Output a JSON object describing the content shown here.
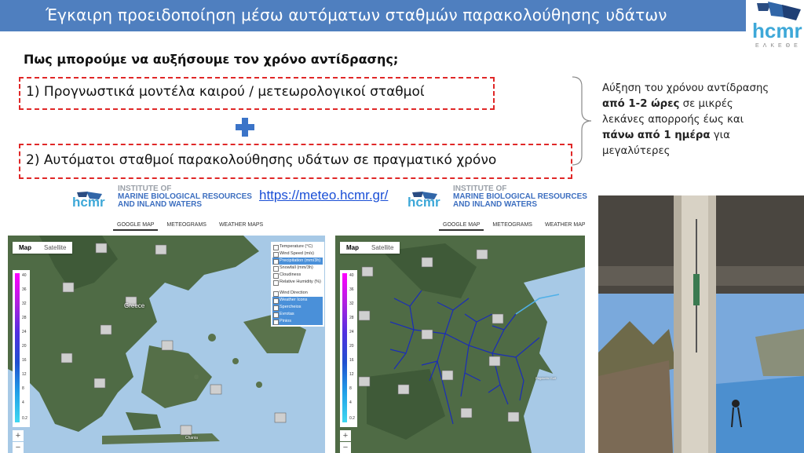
{
  "header": {
    "title": "Έγκαιρη προειδοποίηση μέσω αυτόματων σταθμών παρακολούθησης υδάτων",
    "logo_text": "hcmr",
    "logo_subtext": "ΕΛΚΕΘΕ"
  },
  "question": "Πως μπορούμε να αυξήσουμε τον χρόνο αντίδρασης;",
  "options": [
    "1)  Προγνωστικά μοντέλα καιρού / μετεωρολογικοί σταθμοί",
    "2)  Αυτόματοι σταθμοί παρακολούθησης υδάτων σε πραγματικό χρόνο"
  ],
  "note": {
    "line1": "Αύξηση του χρόνου αντίδρασης",
    "line2_bold": "από 1-2 ώρες",
    "line2_rest": " σε μικρές",
    "line3": "λεκάνες απορροής έως και",
    "line4_bold": "πάνω από 1 ημέρα",
    "line4_rest": " για",
    "line5": "μεγαλύτερες"
  },
  "institute": {
    "logo_text": "hcmr",
    "line1": "INSTITUTE OF",
    "line2": "MARINE BIOLOGICAL RESOURCES",
    "line3": "AND INLAND WATERS"
  },
  "url": "https://meteo.hcmr.gr/",
  "map_nav": {
    "tab1": "GOOGLE MAP",
    "tab2": "METEOGRAMS",
    "tab3": "WEATHER MAPS"
  },
  "map_type": {
    "map": "Map",
    "satellite": "Satellite"
  },
  "scale_labels": [
    "40",
    "36",
    "32",
    "28",
    "24",
    "20",
    "16",
    "12",
    "8",
    "4",
    "0.2"
  ],
  "zoom": {
    "in": "+",
    "out": "−"
  },
  "layers": [
    "Temperature (°C)",
    "Wind Speed (m/s)",
    "Precipitation (mm/3h)",
    "Snowfall (mm/3h)",
    "Cloudiness",
    "Relative Humidity (%)",
    "Wind Direction",
    "Weather Icons",
    "Spercheios",
    "Evrotas",
    "Pinios"
  ],
  "map_labels": {
    "greece": "Greece",
    "chania": "Chania",
    "gulf": "Pagasetic Gulf"
  },
  "colors": {
    "title_bar": "#4f7fbf",
    "dashed_box": "#e02828",
    "plus": "#3b74c8",
    "link": "#1a4fd6"
  }
}
